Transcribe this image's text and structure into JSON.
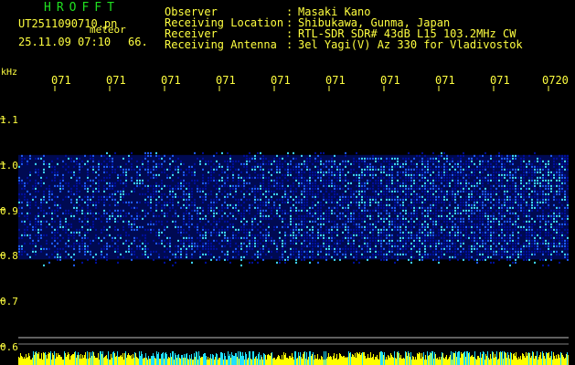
{
  "title": "HROFFT",
  "file_name": "UT2511090710.pn",
  "meteor_label": "meteor",
  "datetime": "25.11.09 07:10",
  "count": "66.",
  "header": [
    {
      "key": "Observer",
      "colon": ":",
      "value": "Masaki Kano"
    },
    {
      "key": "Receiving Location",
      "colon": ":",
      "value": "Shibukawa, Gunma, Japan"
    },
    {
      "key": "Receiver",
      "colon": ":",
      "value": "RTL-SDR SDR# 43dB L15 103.2MHz CW"
    },
    {
      "key": "Receiving Antenna",
      "colon": ":",
      "value": "3el Yagi(V) Az 330 for Vladivostok"
    }
  ],
  "chart_data": {
    "type": "heatmap",
    "ylabel": "kHz",
    "x_ticks": [
      "071",
      "071",
      "071",
      "071",
      "071",
      "071",
      "071",
      "071",
      "071",
      "0720"
    ],
    "y_ticks": [
      "1.1",
      "1.0",
      "0.9",
      "0.8",
      "0.7",
      "0.6"
    ],
    "y_range": [
      0.6,
      1.1
    ],
    "signal_band_khz": [
      0.79,
      1.02
    ],
    "noise_level_profile": [
      0.45,
      0.5,
      0.5,
      0.55,
      0.6,
      0.7,
      0.75,
      0.8,
      0.8,
      0.75
    ],
    "colors": {
      "background": "#000000",
      "low": "#0010a0",
      "mid": "#2060ff",
      "high": "#40e0ff",
      "bottom_bar": "#ffff00",
      "bottom_bar_alt": "#20e0ff",
      "baseline": "#c0c0c0"
    }
  }
}
